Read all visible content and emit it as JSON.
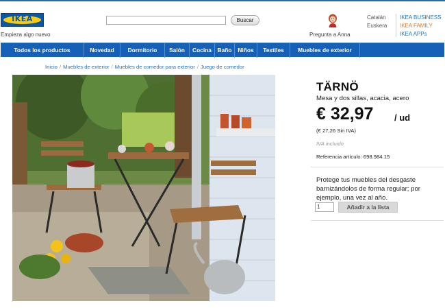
{
  "brand": {
    "logo_text": "IKEA",
    "tagline": "Empieza algo nuevo"
  },
  "search": {
    "placeholder": "",
    "button_label": "Buscar"
  },
  "assistant": {
    "label": "Pregunta a Anna"
  },
  "languages": [
    "Catalán",
    "Euskera"
  ],
  "header_links": [
    {
      "label": "IKEA BUSINESS",
      "color": "#1f77c0"
    },
    {
      "label": "IKEA FAMILY",
      "color": "#e07b28"
    },
    {
      "label": "IKEA APPs",
      "color": "#1f77c0"
    }
  ],
  "nav": {
    "items": [
      "Todos los productos",
      "Novedad",
      "Dormitorio",
      "Salón",
      "Cocina",
      "Baño",
      "Niños",
      "Textiles",
      "Muebles de exterior"
    ]
  },
  "breadcrumb": [
    "Inicio",
    "Muebles de exterior",
    "Muebles de comedor para exterior",
    "Juego de comedor"
  ],
  "product": {
    "name": "TÄRNÖ",
    "description": "Mesa y dos sillas, acacia, acero",
    "price": "€ 32,97",
    "unit": "/ ud",
    "price_without_vat": "(€ 27,26 Sin IVA)",
    "vat_note": "IVA incluido",
    "reference": "Referencia artículo: 698.984.15",
    "tip": "Protege tus muebles del desgaste barnizándolos de forma regular; por ejemplo, una vez al año.",
    "quantity": "1",
    "add_button": "Añadir a la lista"
  },
  "colors": {
    "nav_blue": "#1660b8",
    "link_blue": "#1f6fbf",
    "logo_yellow": "#ffcc00"
  }
}
